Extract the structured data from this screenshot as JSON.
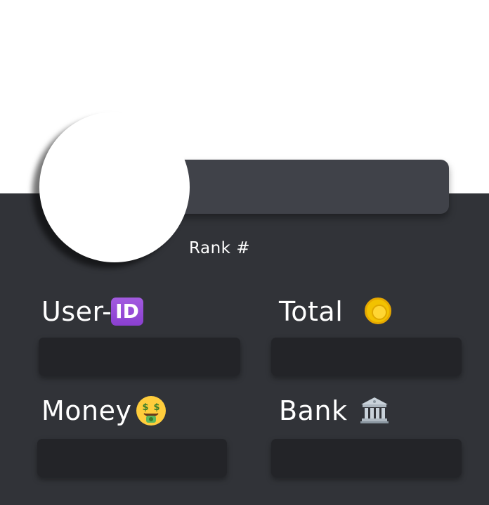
{
  "profile": {
    "rank_label": "Rank #"
  },
  "stats": {
    "user_label": "User-",
    "user_icon": "id-icon",
    "user_icon_text": "ID",
    "total_label": "Total",
    "total_icon": "coin-icon",
    "money_label": "Money",
    "money_icon": "money-mouth-face-icon",
    "bank_label": "Bank",
    "bank_icon": "bank-icon"
  },
  "colors": {
    "card_bg": "#313338",
    "banner_bg": "#404249",
    "field_bg": "#232428",
    "text": "#ffffff"
  }
}
